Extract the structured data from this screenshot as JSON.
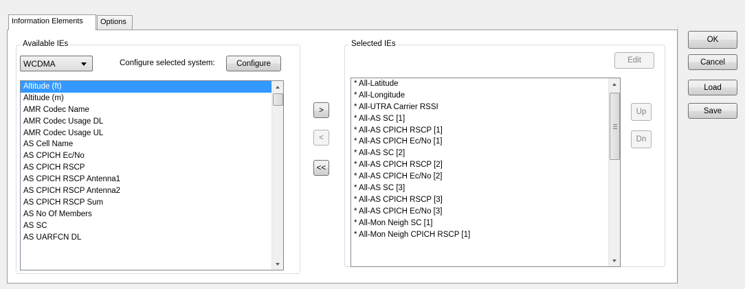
{
  "tabs": [
    {
      "label": "Information Elements",
      "active": true
    },
    {
      "label": "Options",
      "active": false
    }
  ],
  "available": {
    "group_title": "Available IEs",
    "system_select": "WCDMA",
    "configure_label": "Configure selected system:",
    "configure_button": "Configure",
    "items": [
      "Altitude (ft)",
      "Altitude (m)",
      "AMR Codec Name",
      "AMR Codec Usage DL",
      "AMR Codec Usage UL",
      "AS Cell Name",
      "AS CPICH Ec/No",
      "AS CPICH RSCP",
      "AS CPICH RSCP Antenna1",
      "AS CPICH RSCP Antenna2",
      "AS CPICH RSCP Sum",
      "AS No Of Members",
      "AS SC",
      "AS UARFCN DL"
    ],
    "selected_index": 0
  },
  "transfer": {
    "add": ">",
    "remove": "<",
    "remove_all": "<<"
  },
  "selected": {
    "group_title": "Selected IEs",
    "edit_button": "Edit",
    "up_button": "Up",
    "down_button": "Dn",
    "items": [
      "* All-Latitude",
      "* All-Longitude",
      "* All-UTRA Carrier RSSI",
      "* All-AS SC [1]",
      "* All-AS CPICH RSCP [1]",
      "* All-AS CPICH Ec/No [1]",
      "* All-AS SC [2]",
      "* All-AS CPICH RSCP [2]",
      "* All-AS CPICH Ec/No [2]",
      "* All-AS SC [3]",
      "* All-AS CPICH RSCP [3]",
      "* All-AS CPICH Ec/No [3]",
      "* All-Mon Neigh SC [1]",
      "* All-Mon Neigh CPICH RSCP [1]"
    ]
  },
  "dialog_buttons": {
    "ok": "OK",
    "cancel": "Cancel",
    "load": "Load",
    "save": "Save"
  },
  "colors": {
    "selection": "#3399ff",
    "panel_background": "#ffffff",
    "window_background": "#f0f0f0"
  },
  "icons": {
    "dropdown": "chevron-down-icon",
    "scroll_up": "arrow-up-icon",
    "scroll_down": "arrow-down-icon",
    "scroll_grip": "grip-icon"
  }
}
